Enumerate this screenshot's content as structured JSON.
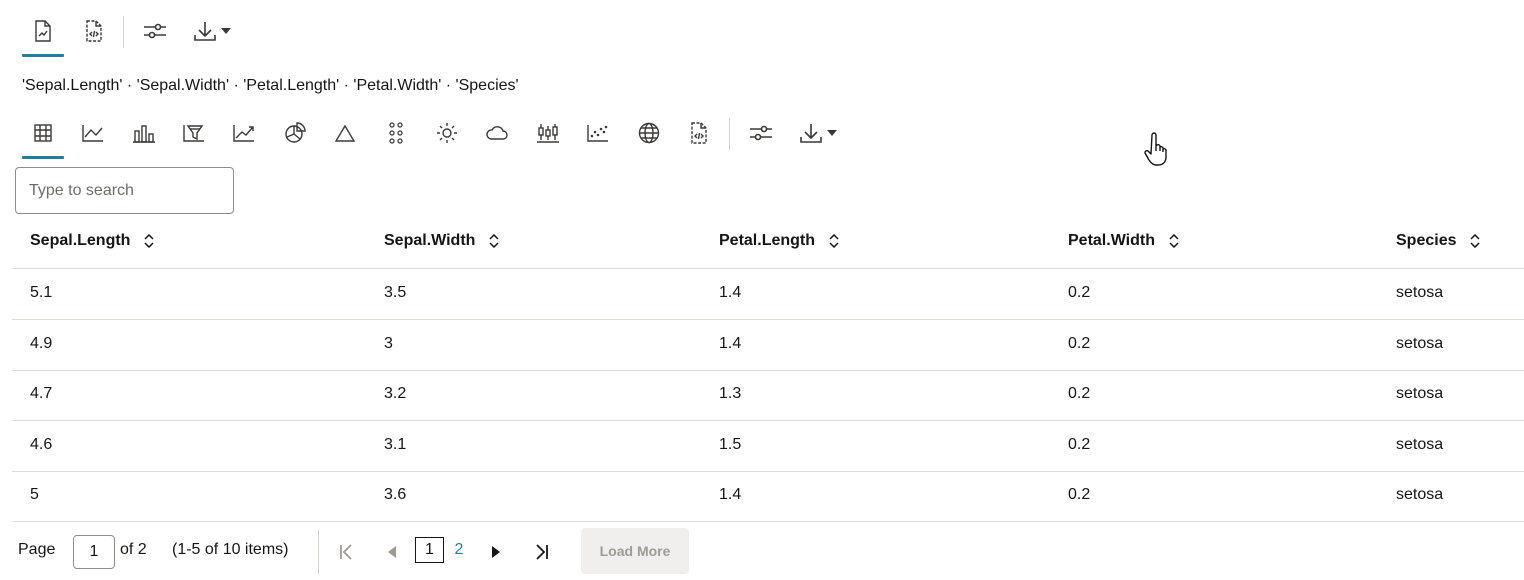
{
  "top_toolbar": {
    "items": [
      {
        "name": "report-view-icon",
        "active": true
      },
      {
        "name": "code-view-icon",
        "active": false
      },
      {
        "name": "settings-icon",
        "active": false
      },
      {
        "name": "download-icon",
        "active": false
      }
    ]
  },
  "fields_line": "'Sepal.Length' · 'Sepal.Width' · 'Petal.Length' · 'Petal.Width' · 'Species'",
  "viz_toolbar": {
    "items": [
      "table-icon",
      "line-chart-icon",
      "bar-chart-icon",
      "funnel-chart-icon",
      "area-chart-icon",
      "pie-chart-icon",
      "pyramid-icon",
      "dots-grid-icon",
      "sunburst-icon",
      "word-cloud-icon",
      "box-plot-icon",
      "scatter-plot-icon",
      "map-icon",
      "code-view-icon",
      "settings-icon",
      "download-icon"
    ],
    "active": "table-icon"
  },
  "search": {
    "placeholder": "Type to search",
    "value": ""
  },
  "table": {
    "columns": [
      "Sepal.Length",
      "Sepal.Width",
      "Petal.Length",
      "Petal.Width",
      "Species"
    ],
    "rows": [
      [
        "5.1",
        "3.5",
        "1.4",
        "0.2",
        "setosa"
      ],
      [
        "4.9",
        "3",
        "1.4",
        "0.2",
        "setosa"
      ],
      [
        "4.7",
        "3.2",
        "1.3",
        "0.2",
        "setosa"
      ],
      [
        "4.6",
        "3.1",
        "1.5",
        "0.2",
        "setosa"
      ],
      [
        "5",
        "3.6",
        "1.4",
        "0.2",
        "setosa"
      ]
    ]
  },
  "pagination": {
    "page_label": "Page",
    "page_value": "1",
    "of_label": "of 2",
    "items_label": "(1-5 of 10 items)",
    "pages": [
      "1",
      "2"
    ],
    "current_page": "1",
    "load_more": "Load More"
  },
  "colors": {
    "accent": "#227e9e",
    "text": "#161513",
    "icon": "#3a3937",
    "border": "#dedad6"
  }
}
